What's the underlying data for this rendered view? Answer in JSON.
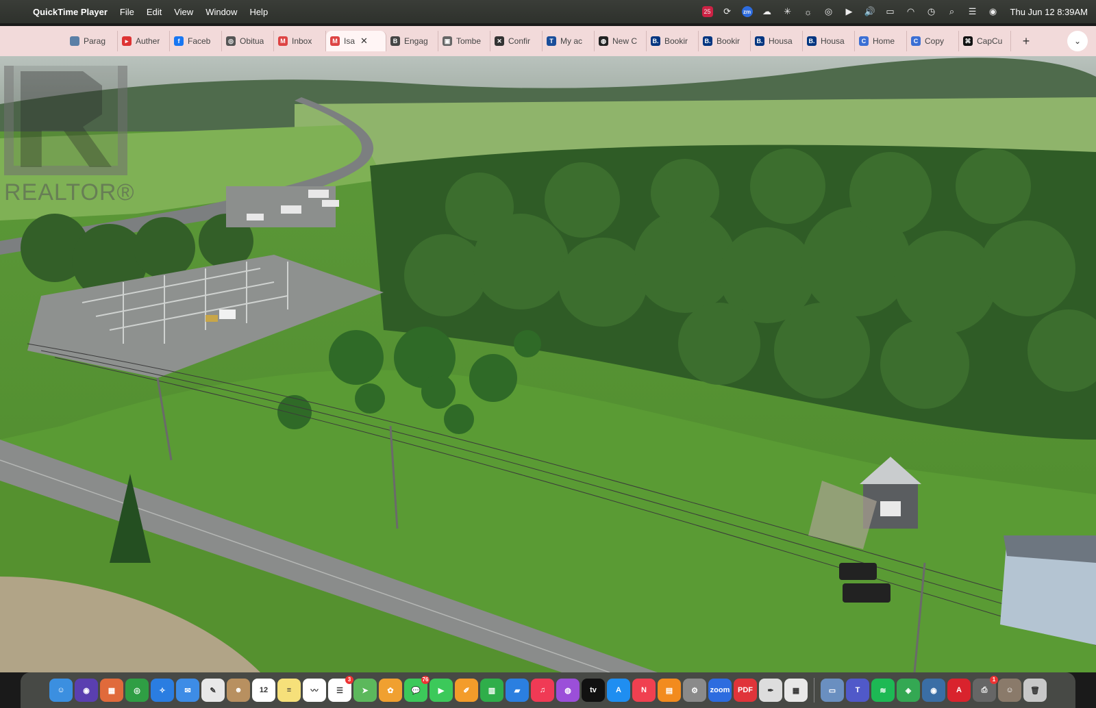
{
  "menubar": {
    "app_name": "QuickTime Player",
    "menus": [
      "File",
      "Edit",
      "View",
      "Window",
      "Help"
    ],
    "clock": "Thu Jun 12  8:39AM",
    "status_badge_count": "25",
    "zoom_status_label": "zm"
  },
  "tabs": [
    {
      "label": "Parag",
      "icon": "paragon-icon",
      "color": "#5a7fa6",
      "glyph": ""
    },
    {
      "label": "Auther",
      "icon": "author-icon",
      "color": "#d33",
      "glyph": "▸"
    },
    {
      "label": "Faceb",
      "icon": "facebook-icon",
      "color": "#1877f2",
      "glyph": "f"
    },
    {
      "label": "Obitua",
      "icon": "obituary-icon",
      "color": "#555",
      "glyph": "◎"
    },
    {
      "label": "Inbox",
      "icon": "gmail-icon",
      "color": "#d44",
      "glyph": "M"
    },
    {
      "label": "Isa",
      "icon": "gmail-icon",
      "color": "#d44",
      "glyph": "M",
      "active": true
    },
    {
      "label": "Engag",
      "icon": "engage-icon",
      "color": "#444",
      "glyph": "B"
    },
    {
      "label": "Tombe",
      "icon": "tomb-icon",
      "color": "#666",
      "glyph": "▣"
    },
    {
      "label": "Confir",
      "icon": "x-icon",
      "color": "#333",
      "glyph": "✕"
    },
    {
      "label": "My ac",
      "icon": "account-icon",
      "color": "#1a4e9a",
      "glyph": "T"
    },
    {
      "label": "New C",
      "icon": "openai-icon",
      "color": "#222",
      "glyph": "◍"
    },
    {
      "label": "Bookir",
      "icon": "booking-icon",
      "color": "#003580",
      "glyph": "B."
    },
    {
      "label": "Bookir",
      "icon": "booking-icon",
      "color": "#003580",
      "glyph": "B."
    },
    {
      "label": "Housa",
      "icon": "booking-icon",
      "color": "#003580",
      "glyph": "B."
    },
    {
      "label": "Housa",
      "icon": "booking-icon",
      "color": "#003580",
      "glyph": "B."
    },
    {
      "label": "Home",
      "icon": "home-c-icon",
      "color": "#3b6fd4",
      "glyph": "C"
    },
    {
      "label": "Copy",
      "icon": "copy-c-icon",
      "color": "#3b6fd4",
      "glyph": "C"
    },
    {
      "label": "CapCu",
      "icon": "capcut-icon",
      "color": "#111",
      "glyph": "⌘"
    }
  ],
  "newtab_label": "+",
  "video": {
    "watermark_text": "REALTOR®"
  },
  "dock": {
    "apps": [
      {
        "name": "finder-icon",
        "color": "#3b8fe0",
        "glyph": "☺"
      },
      {
        "name": "siri-icon",
        "color": "#5a3fb0",
        "glyph": "◉"
      },
      {
        "name": "launchpad-icon",
        "color": "#e06a3b",
        "glyph": "▦"
      },
      {
        "name": "chrome-icon",
        "color": "#2f9e44",
        "glyph": "◎"
      },
      {
        "name": "safari-icon",
        "color": "#2a7de1",
        "glyph": "✧"
      },
      {
        "name": "mail-icon",
        "color": "#3d8ce6",
        "glyph": "✉"
      },
      {
        "name": "texteditor-icon",
        "color": "#e8e8e8",
        "glyph": "✎"
      },
      {
        "name": "contacts-icon",
        "color": "#b89060",
        "glyph": "☻"
      },
      {
        "name": "calendar-icon",
        "color": "#ffffff",
        "glyph": "12"
      },
      {
        "name": "notes-icon",
        "color": "#f6e07a",
        "glyph": "≡"
      },
      {
        "name": "freeform-icon",
        "color": "#ffffff",
        "glyph": "〰"
      },
      {
        "name": "reminders-icon",
        "color": "#ffffff",
        "glyph": "☰",
        "badge": "3"
      },
      {
        "name": "maps-icon",
        "color": "#5cb85c",
        "glyph": "➤"
      },
      {
        "name": "photos-icon",
        "color": "#f0a030",
        "glyph": "✿"
      },
      {
        "name": "messages-icon",
        "color": "#3cc95a",
        "glyph": "💬",
        "badge": "76"
      },
      {
        "name": "facetime-icon",
        "color": "#3cc95a",
        "glyph": "▶"
      },
      {
        "name": "pages-icon",
        "color": "#f39c2a",
        "glyph": "✐"
      },
      {
        "name": "numbers-icon",
        "color": "#2fae4a",
        "glyph": "▥"
      },
      {
        "name": "keynote-icon",
        "color": "#2b7fe0",
        "glyph": "▰"
      },
      {
        "name": "music-icon",
        "color": "#f03a55",
        "glyph": "♫"
      },
      {
        "name": "podcasts-icon",
        "color": "#9b4fd9",
        "glyph": "◍"
      },
      {
        "name": "appletv-icon",
        "color": "#111111",
        "glyph": "tv"
      },
      {
        "name": "appstore-icon",
        "color": "#1f8ef1",
        "glyph": "A"
      },
      {
        "name": "news-icon",
        "color": "#f04050",
        "glyph": "N"
      },
      {
        "name": "books-icon",
        "color": "#f28b1e",
        "glyph": "▤"
      },
      {
        "name": "settings-icon",
        "color": "#8a8a8a",
        "glyph": "⚙"
      },
      {
        "name": "zoom-icon",
        "color": "#2d6cdf",
        "glyph": "zoom"
      },
      {
        "name": "pdf-icon",
        "color": "#e0343a",
        "glyph": "PDF"
      },
      {
        "name": "pen-icon",
        "color": "#dddddd",
        "glyph": "✒"
      },
      {
        "name": "preview-icon",
        "color": "#e8e8e8",
        "glyph": "▦"
      },
      {
        "name": "screensharing-icon",
        "color": "#6a8fc0",
        "glyph": "▭"
      },
      {
        "name": "teams-icon",
        "color": "#5059c9",
        "glyph": "T"
      },
      {
        "name": "spotify-icon",
        "color": "#1db954",
        "glyph": "≋"
      },
      {
        "name": "maps-pin-icon",
        "color": "#34a853",
        "glyph": "◈"
      },
      {
        "name": "search-app-icon",
        "color": "#3a6ea5",
        "glyph": "◉"
      },
      {
        "name": "acrobat-icon",
        "color": "#d9232d",
        "glyph": "A"
      },
      {
        "name": "printer-icon",
        "color": "#666666",
        "glyph": "⎙",
        "badge": "1"
      },
      {
        "name": "photo-thumb-icon",
        "color": "#8a7a6a",
        "glyph": "☺"
      },
      {
        "name": "trash-icon",
        "color": "#c8c8c8",
        "glyph": "🗑"
      }
    ]
  }
}
